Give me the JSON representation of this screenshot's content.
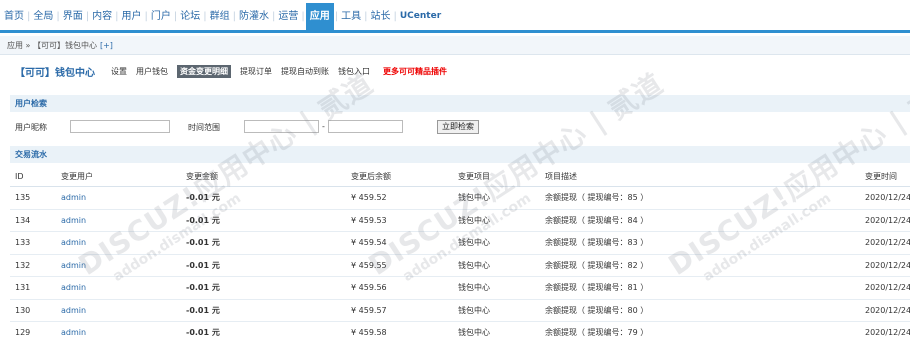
{
  "topnav": {
    "items": [
      "首页",
      "全局",
      "界面",
      "内容",
      "用户",
      "门户",
      "论坛",
      "群组",
      "防灌水",
      "运营",
      "应用",
      "工具",
      "站长",
      "UCenter"
    ],
    "active_index": 10
  },
  "breadcrumb": {
    "text": "应用 » 【可可】钱包中心",
    "plus": "[+]"
  },
  "subnav": {
    "title": "【可可】钱包中心",
    "tabs": [
      "设置",
      "用户钱包",
      "资金变更明细",
      "提现订单",
      "提现自动到账",
      "钱包入口"
    ],
    "active_tab": "资金变更明细",
    "promo": "更多可可精品插件"
  },
  "search": {
    "section_title": "用户检索",
    "nickname_label": "用户昵称",
    "nickname_value": "",
    "time_label": "时间范围",
    "time_from": "",
    "time_to": "",
    "range_separator": "-",
    "submit_label": "立即检索"
  },
  "flow": {
    "section_title": "交易流水",
    "columns": [
      "ID",
      "变更用户",
      "变更金额",
      "变更后余额",
      "变更项目",
      "项目描述",
      "变更时间"
    ],
    "rows": [
      {
        "id": "135",
        "user": "admin",
        "amount": "-0.01 元",
        "balance": "¥ 459.52",
        "item": "钱包中心",
        "desc": "余额提现（ 提现编号：85 ）",
        "time": "2020/12/24"
      },
      {
        "id": "134",
        "user": "admin",
        "amount": "-0.01 元",
        "balance": "¥ 459.53",
        "item": "钱包中心",
        "desc": "余额提现（ 提现编号：84 ）",
        "time": "2020/12/24"
      },
      {
        "id": "133",
        "user": "admin",
        "amount": "-0.01 元",
        "balance": "¥ 459.54",
        "item": "钱包中心",
        "desc": "余额提现（ 提现编号：83 ）",
        "time": "2020/12/24"
      },
      {
        "id": "132",
        "user": "admin",
        "amount": "-0.01 元",
        "balance": "¥ 459.55",
        "item": "钱包中心",
        "desc": "余额提现（ 提现编号：82 ）",
        "time": "2020/12/24"
      },
      {
        "id": "131",
        "user": "admin",
        "amount": "-0.01 元",
        "balance": "¥ 459.56",
        "item": "钱包中心",
        "desc": "余额提现（ 提现编号：81 ）",
        "time": "2020/12/24"
      },
      {
        "id": "130",
        "user": "admin",
        "amount": "-0.01 元",
        "balance": "¥ 459.57",
        "item": "钱包中心",
        "desc": "余额提现（ 提现编号：80 ）",
        "time": "2020/12/24"
      },
      {
        "id": "129",
        "user": "admin",
        "amount": "-0.01 元",
        "balance": "¥ 459.58",
        "item": "钱包中心",
        "desc": "余额提现（ 提现编号：79 ）",
        "time": "2020/12/24"
      }
    ]
  },
  "watermark": {
    "brand": "DISCUZ!应用中心 | 贰道",
    "domain": "addon.dismall.com"
  },
  "colors": {
    "accent": "#2f8fd0",
    "link": "#2b6aa8",
    "promo": "#ee0000",
    "section_bg": "#eaf2f8"
  }
}
